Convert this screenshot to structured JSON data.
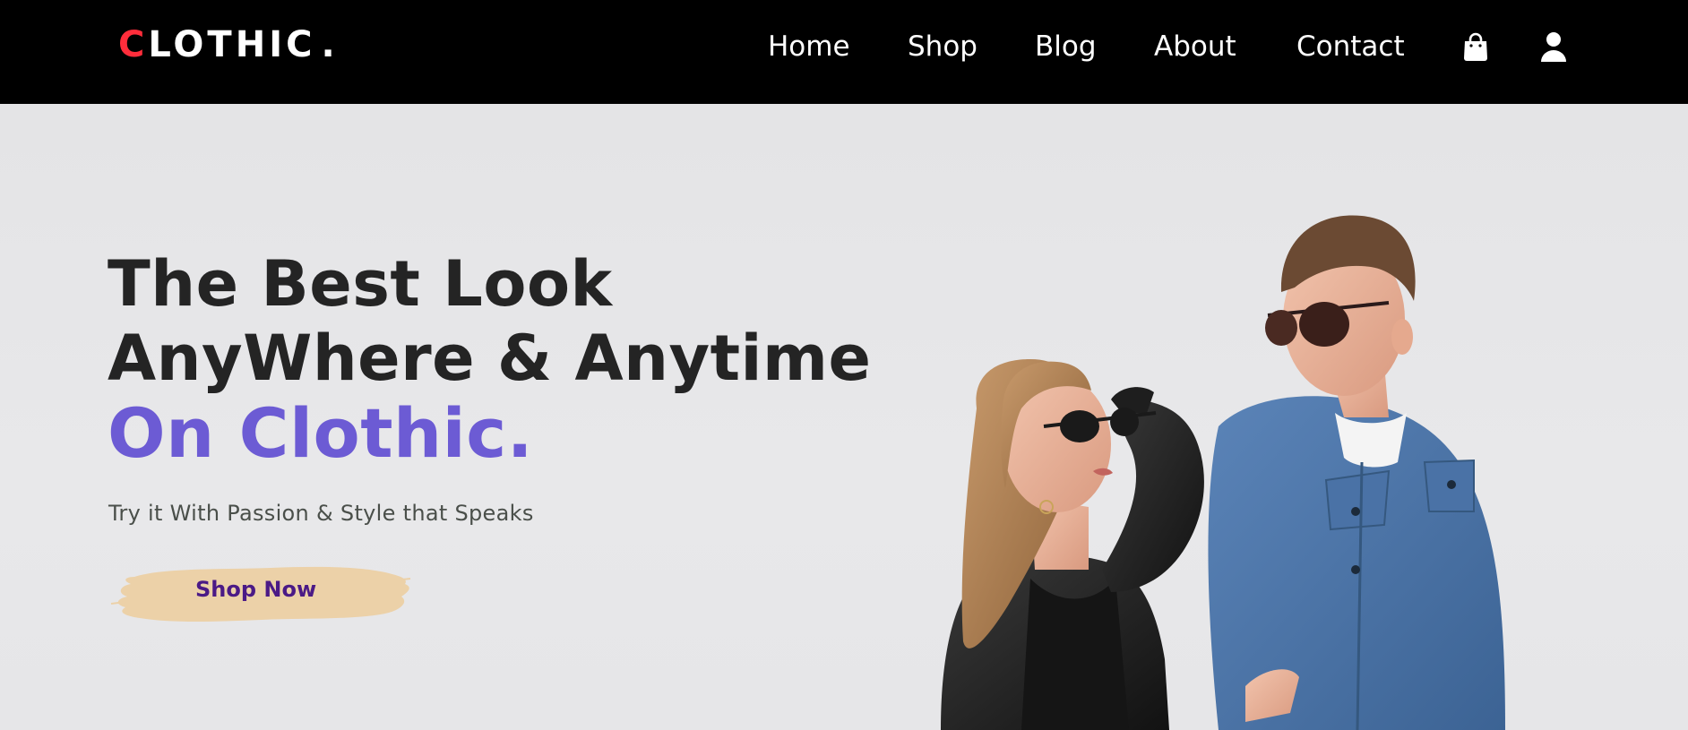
{
  "brand": {
    "first_letter": "C",
    "rest": "LOTHIC",
    "dot": "."
  },
  "nav": {
    "items": [
      {
        "label": "Home"
      },
      {
        "label": "Shop"
      },
      {
        "label": "Blog"
      },
      {
        "label": "About"
      },
      {
        "label": "Contact"
      }
    ],
    "icons": [
      "shopping-bag-icon",
      "user-icon"
    ]
  },
  "hero": {
    "title_line1": "The Best Look",
    "title_line2": "AnyWhere & Anytime",
    "title_line3": "On Clothic.",
    "subtitle": "Try it With Passion & Style that Speaks",
    "cta_label": "Shop Now"
  },
  "colors": {
    "header_bg": "#000000",
    "brand_accent": "#ff2d3b",
    "title_accent": "#6c5bd4",
    "cta_brush": "#ecd1a8",
    "cta_text": "#4b1a86"
  }
}
